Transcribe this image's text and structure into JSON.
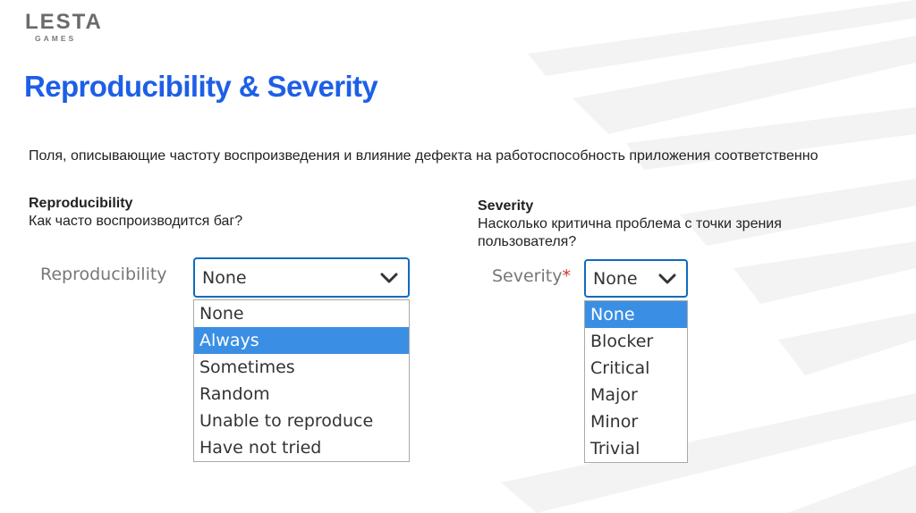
{
  "logo": {
    "main": "LESTA",
    "sub": "GAMES"
  },
  "title": "Reproducibility & Severity",
  "description": "Поля, описывающие частоту воспроизведения и влияние дефекта на работоспособность приложения соответственно",
  "reproducibility": {
    "heading": "Reproducibility",
    "question": "Как часто воспроизводится баг?",
    "field_label": "Reproducibility",
    "selected_value": "None",
    "options": [
      "None",
      "Always",
      "Sometimes",
      "Random",
      "Unable to reproduce",
      "Have not tried"
    ],
    "highlighted_index": 1
  },
  "severity": {
    "heading": "Severity",
    "question": "Насколько критична проблема с точки зрения пользователя?",
    "field_label": "Severity",
    "required_mark": "*",
    "selected_value": "None",
    "options": [
      "None",
      "Blocker",
      "Critical",
      "Major",
      "Minor",
      "Trivial"
    ],
    "highlighted_index": 0
  },
  "colors": {
    "title": "#1d5fe6",
    "focus_border": "#0f6cbd",
    "highlight": "#3a8fe4",
    "required": "#d0342c"
  },
  "icons": {
    "dropdown": "chevron-down-icon"
  }
}
